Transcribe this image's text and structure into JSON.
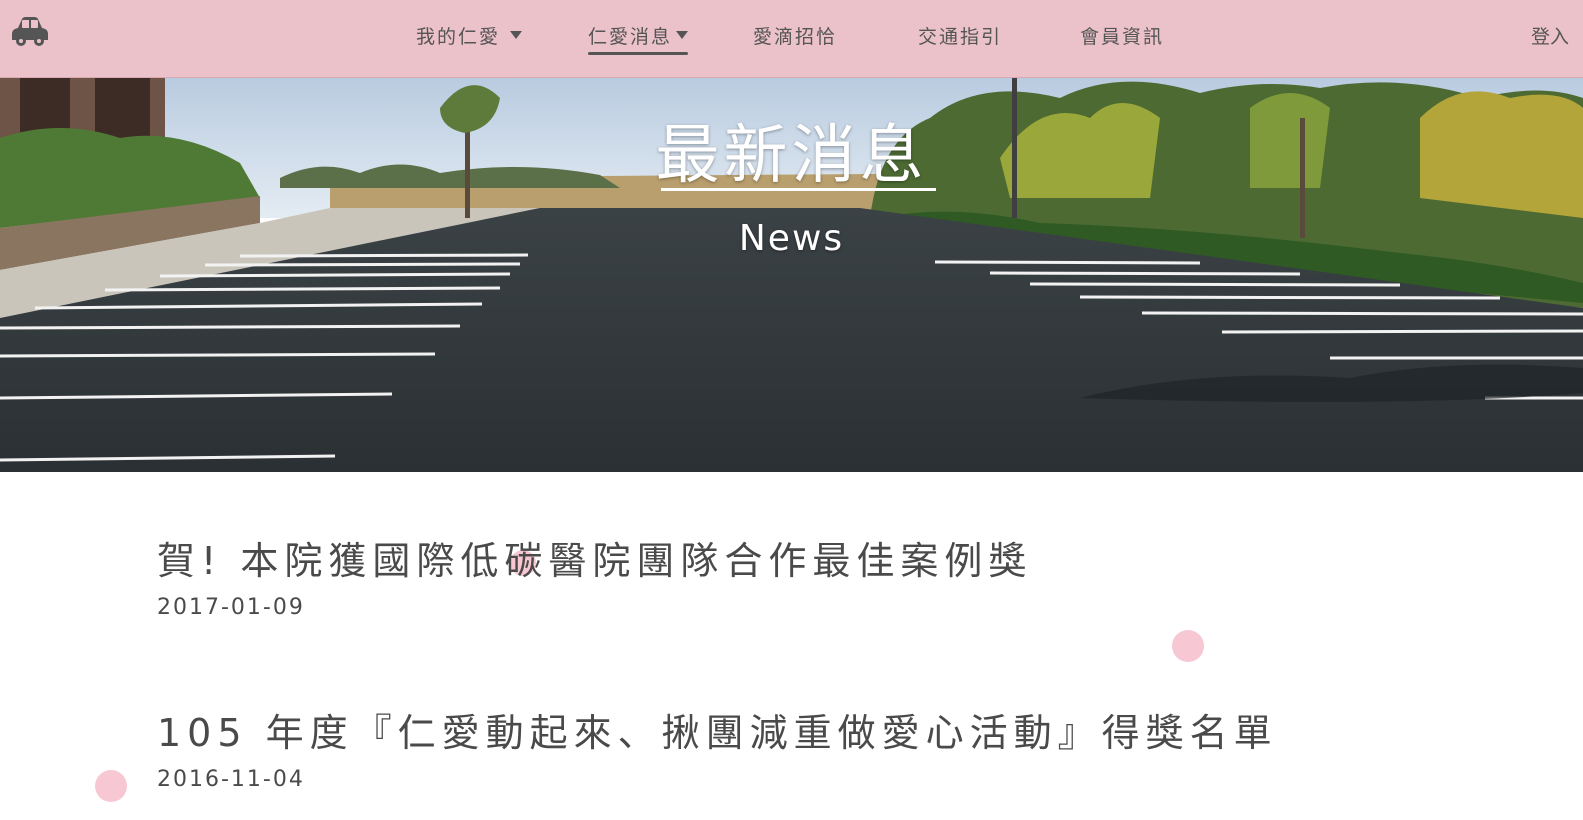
{
  "nav": {
    "items": [
      {
        "label": "我的仁愛"
      },
      {
        "label": "仁愛消息"
      },
      {
        "label": "愛滴招恰"
      },
      {
        "label": "交通指引"
      },
      {
        "label": "會員資訊"
      }
    ],
    "login_label": "登入"
  },
  "hero": {
    "title": "最新消息",
    "subtitle": "News"
  },
  "news": [
    {
      "title": "賀! 本院獲國際低碳醫院團隊合作最佳案例獎",
      "date": "2017-01-09"
    },
    {
      "title": "105 年度『仁愛動起來、揪團減重做愛心活動』得獎名單",
      "date": "2016-11-04"
    }
  ],
  "colors": {
    "navbar_bg": "#ebc1ca",
    "dot": "#f7c8d3",
    "text": "#4a4a4a"
  },
  "icons": {
    "logo": "car-icon",
    "dropdown": "caret-down-icon"
  }
}
